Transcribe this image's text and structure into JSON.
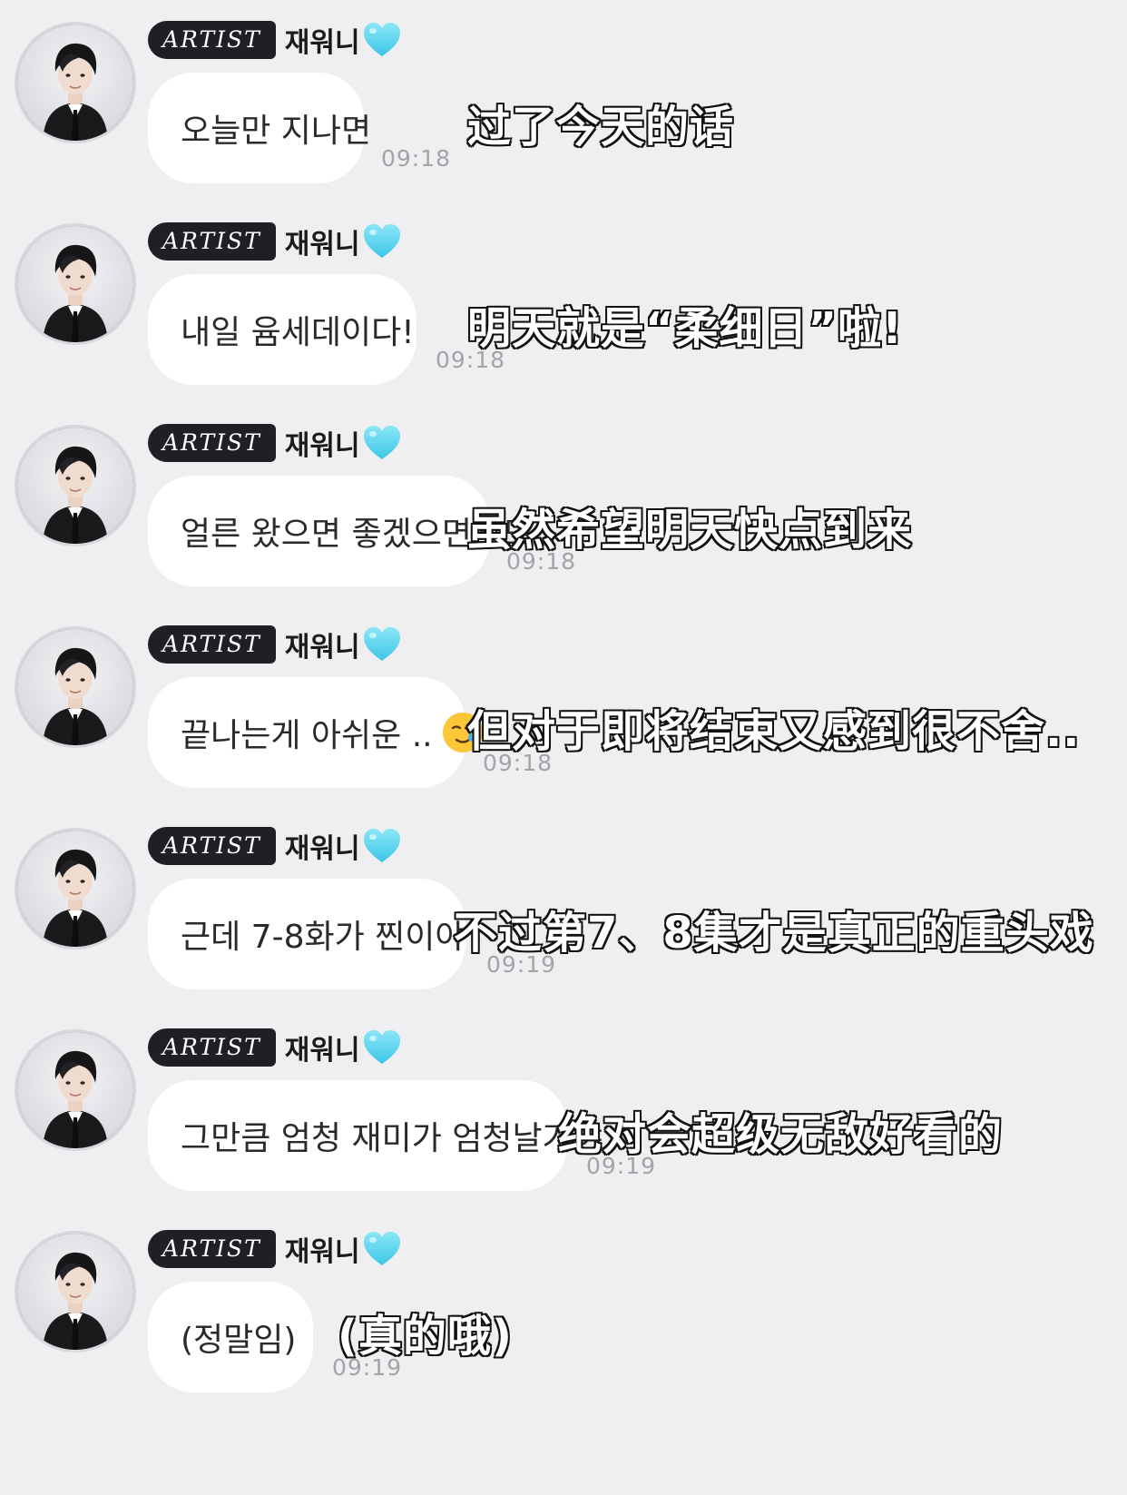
{
  "messages": [
    {
      "badge": "ARTIST",
      "name": "재워니",
      "text": "오늘만 지나면",
      "emoji": "",
      "time": "09:18",
      "caption": "过了今天的话"
    },
    {
      "badge": "ARTIST",
      "name": "재워니",
      "text": "내일 윰세데이다!",
      "emoji": "",
      "time": "09:18",
      "caption": "明天就是“柔细日”啦!"
    },
    {
      "badge": "ARTIST",
      "name": "재워니",
      "text": "얼른 왔으면 좋겠으면서도",
      "emoji": "",
      "time": "09:18",
      "caption": "虽然希望明天快点到来"
    },
    {
      "badge": "ARTIST",
      "name": "재워니",
      "text": "끝나는게 아쉬운 ..",
      "emoji": "smiling-face-with-tear-emoji",
      "time": "09:18",
      "caption": "但对于即将结束又感到很不舍.."
    },
    {
      "badge": "ARTIST",
      "name": "재워니",
      "text": "근데 7-8화가 찐이야",
      "emoji": "",
      "time": "09:19",
      "caption": "不过第7、8集才是真正的重头戏"
    },
    {
      "badge": "ARTIST",
      "name": "재워니",
      "text": "그만큼 엄청 재미가 엄청날거야",
      "emoji": "",
      "time": "09:19",
      "caption": "绝对会超级无敌好看的"
    },
    {
      "badge": "ARTIST",
      "name": "재워니",
      "text": "(정말임)",
      "emoji": "",
      "time": "09:19",
      "caption": "(真的哦)"
    }
  ],
  "icons": {
    "heart": "light-blue-heart-icon",
    "avatar": "profile-photo-avatar"
  },
  "colors": {
    "background": "#efeff1",
    "bubble": "#ffffff",
    "badge": "#1e2023",
    "heart": "#5fd6ee",
    "time": "#a3a3a8"
  }
}
